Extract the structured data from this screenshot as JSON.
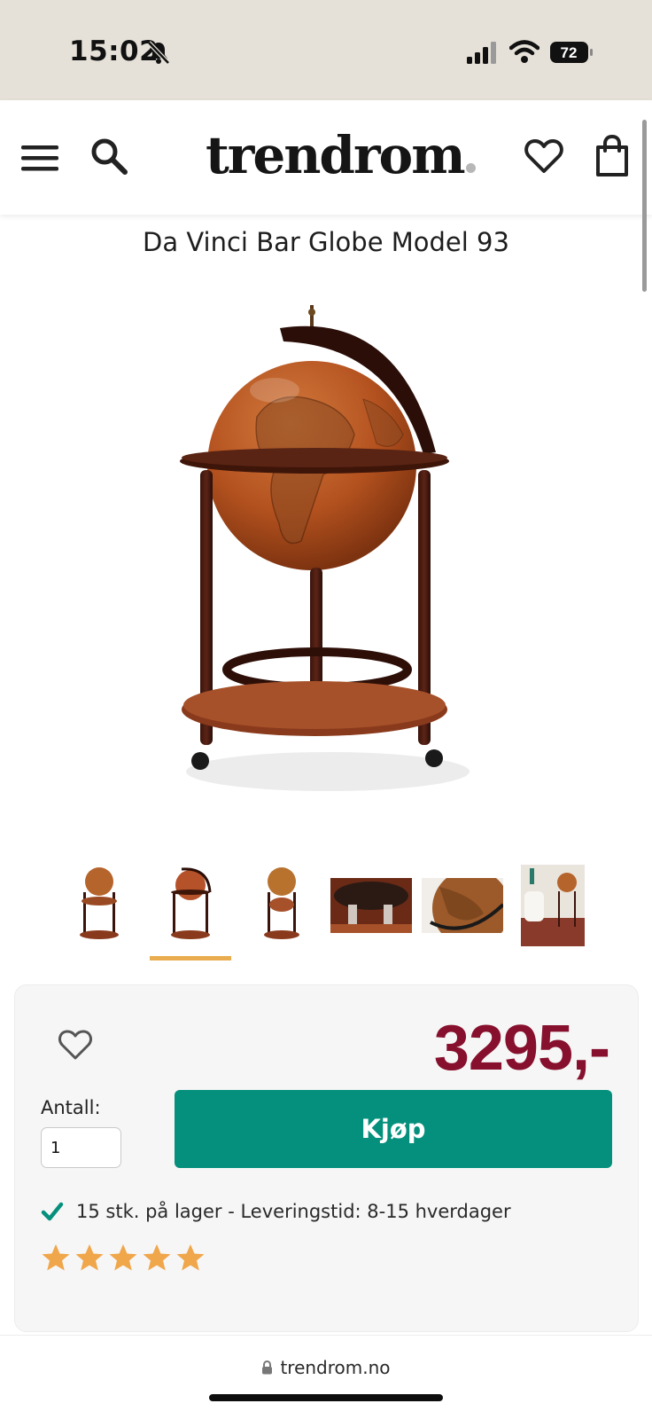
{
  "status_bar": {
    "time": "15:02",
    "battery": "72"
  },
  "header": {
    "logo": "trendrom",
    "icons": [
      "menu-icon",
      "search-icon",
      "heart-icon",
      "shopping-bag-icon"
    ]
  },
  "product": {
    "title": "Da Vinci Bar Globe Model 93",
    "thumbnails_count": 6,
    "active_thumbnail": 2,
    "price": "3295,-",
    "quantity_label": "Antall:",
    "quantity_value": "1",
    "buy_label": "Kjøp",
    "stock_text": "15 stk. på lager - Leveringstid: 8-15 hverdager",
    "rating_stars": 5
  },
  "browser": {
    "url": "trendrom.no"
  },
  "colors": {
    "price": "#86102d",
    "buy_button": "#04907c",
    "active_thumb_bar": "#e9ad4f",
    "star": "#f0a64a",
    "check": "#04907c"
  }
}
